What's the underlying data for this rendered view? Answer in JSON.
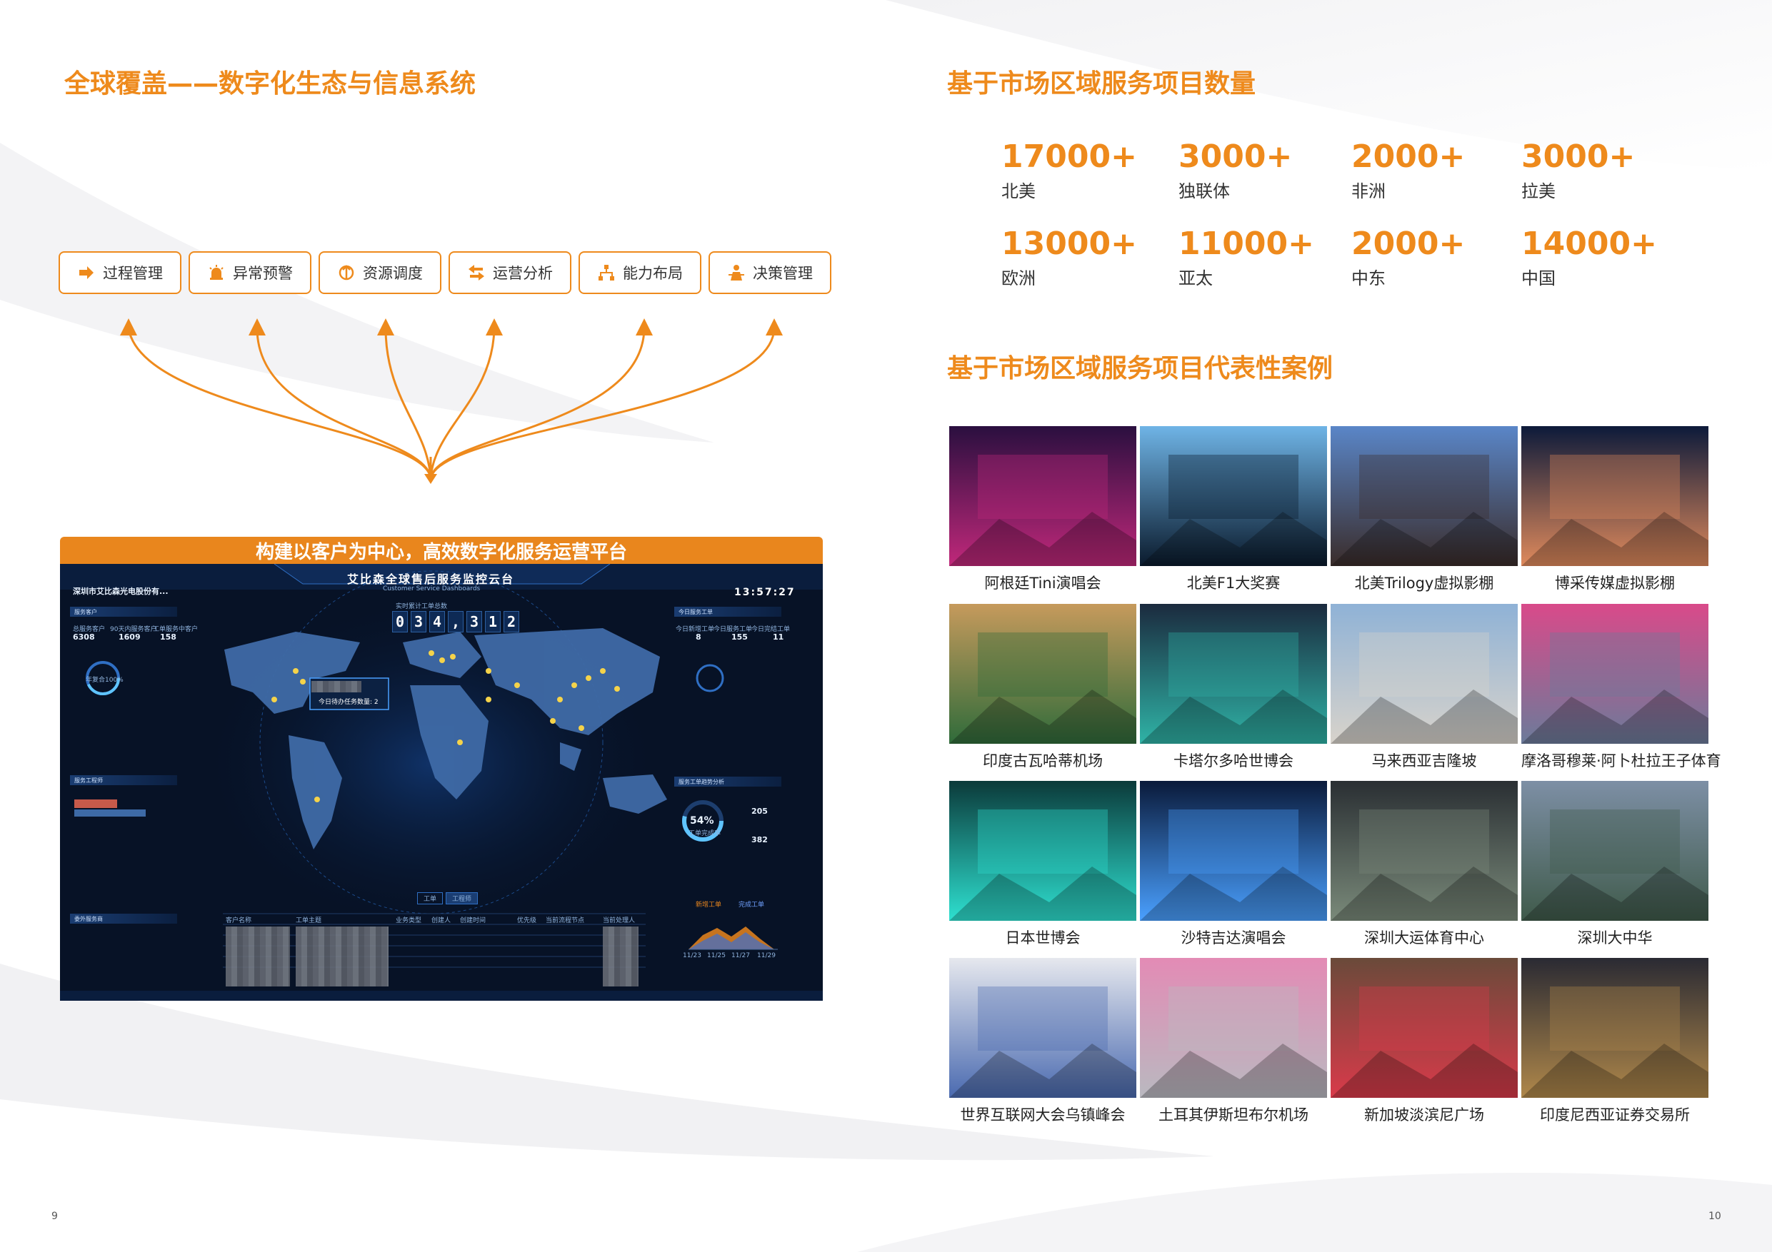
{
  "left": {
    "title": "全球覆盖——数字化生态与信息系统",
    "modules": [
      {
        "label": "过程管理",
        "icon": "arrow-right-icon"
      },
      {
        "label": "异常预警",
        "icon": "alarm-icon"
      },
      {
        "label": "资源调度",
        "icon": "dispatch-icon"
      },
      {
        "label": "运营分析",
        "icon": "swap-arrows-icon"
      },
      {
        "label": "能力布局",
        "icon": "org-chart-icon"
      },
      {
        "label": "决策管理",
        "icon": "decision-person-icon"
      }
    ],
    "dashboard": {
      "banner": "构建以客户为中心，高效数字化服务运营平台",
      "screen_title": "艾比森全球售后服务监控云台",
      "screen_subtitle": "Customer Service Dashboards",
      "company": "深圳市艾比森光电股份有...",
      "clock": "13:57:27",
      "counter_label": "实时累计工单总数",
      "counter_digits": [
        "0",
        "3",
        "4",
        ",",
        "3",
        "1",
        "2"
      ],
      "left_panel_1": "服务客户",
      "left_stats": [
        {
          "label": "总服务客户",
          "value": "6308"
        },
        {
          "label": "90天内服务客户",
          "value": "1609"
        },
        {
          "label": "工单服务中客户",
          "value": "158"
        }
      ],
      "ring_label": "年复合100%",
      "left_panel_2": "服务工程师",
      "left_panel_3": "委外服务商",
      "right_panel_1": "今日服务工单",
      "right_stats": [
        {
          "label": "今日新增工单",
          "value": "8"
        },
        {
          "label": "今日服务工单",
          "value": "155"
        },
        {
          "label": "今日完结工单",
          "value": "11"
        }
      ],
      "right_panel_2": "服务工单趋势分析",
      "percent": "54%",
      "percent_label": "工单完成率",
      "trend_values": [
        "205",
        "382"
      ],
      "task_popup": "今日待办任务数量: 2",
      "tabs": [
        "工单",
        "工程师"
      ],
      "table_headers": [
        "客户名称",
        "工单主题",
        "业务类型",
        "创建人",
        "创建时间",
        "优先级",
        "当前流程节点",
        "当前处理人"
      ],
      "legend": [
        "新增工单",
        "完成工单"
      ],
      "x_ticks": [
        "11/23",
        "11/25",
        "11/27",
        "11/29"
      ]
    }
  },
  "stats": {
    "title": "基于市场区域服务项目数量",
    "items": [
      {
        "value": "17000+",
        "region": "北美"
      },
      {
        "value": "3000+",
        "region": "独联体"
      },
      {
        "value": "2000+",
        "region": "非洲"
      },
      {
        "value": "3000+",
        "region": "拉美"
      },
      {
        "value": "13000+",
        "region": "欧洲"
      },
      {
        "value": "11000+",
        "region": "亚太"
      },
      {
        "value": "2000+",
        "region": "中东"
      },
      {
        "value": "14000+",
        "region": "中国"
      }
    ]
  },
  "cases": {
    "title": "基于市场区域服务项目代表性案例",
    "items": [
      {
        "caption": "阿根廷Tini演唱会",
        "color_a": "#2a0f3f",
        "color_b": "#c0287a"
      },
      {
        "caption": "北美F1大奖赛",
        "color_a": "#6fb4e6",
        "color_b": "#0a1a2c"
      },
      {
        "caption": "北美Trilogy虚拟影棚",
        "color_a": "#5a86c8",
        "color_b": "#3a2c2a"
      },
      {
        "caption": "博采传媒虚拟影棚",
        "color_a": "#0c1a3a",
        "color_b": "#e08a5c"
      },
      {
        "caption": "印度古瓦哈蒂机场",
        "color_a": "#c69a5c",
        "color_b": "#2f6b3a"
      },
      {
        "caption": "卡塔尔多哈世博会",
        "color_a": "#1b2a3e",
        "color_b": "#2fb3a6"
      },
      {
        "caption": "马来西亚吉隆坡",
        "color_a": "#8fb2d6",
        "color_b": "#d8d3cb"
      },
      {
        "caption": "摩洛哥穆莱·阿卜杜拉王子体育",
        "color_a": "#d94a8a",
        "color_b": "#6b7b9a"
      },
      {
        "caption": "日本世博会",
        "color_a": "#0b3a3a",
        "color_b": "#2ee0d0"
      },
      {
        "caption": "沙特吉达演唱会",
        "color_a": "#0a1a3a",
        "color_b": "#4aa0ff"
      },
      {
        "caption": "深圳大运体育中心",
        "color_a": "#2a2f33",
        "color_b": "#7a8a7a"
      },
      {
        "caption": "深圳大中华",
        "color_a": "#7d8fa5",
        "color_b": "#3f5a4a"
      },
      {
        "caption": "世界互联网大会乌镇峰会",
        "color_a": "#e6e8ee",
        "color_b": "#4a6ab0"
      },
      {
        "caption": "土耳其伊斯坦布尔机场",
        "color_a": "#e38bb5",
        "color_b": "#b9b9c0"
      },
      {
        "caption": "新加坡淡滨尼广场",
        "color_a": "#6a4a3a",
        "color_b": "#d93a4a"
      },
      {
        "caption": "印度尼西亚证券交易所",
        "color_a": "#2a2a33",
        "color_b": "#b0884a"
      }
    ]
  },
  "page_numbers": {
    "left": "9",
    "right": "10"
  },
  "colors": {
    "accent": "#ee8a1c",
    "dashboard_bg": "#071226"
  }
}
